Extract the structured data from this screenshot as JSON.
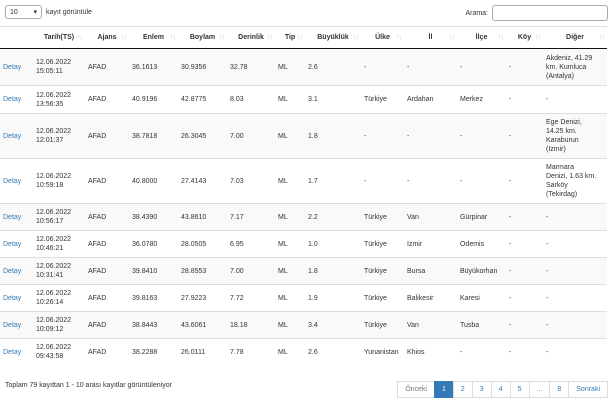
{
  "length_menu": {
    "value": "10",
    "suffix": "kayıt görüntüle"
  },
  "search": {
    "label": "Arama:",
    "placeholder": ""
  },
  "columns": [
    "",
    "Tarih(TS)",
    "Ajans",
    "Enlem",
    "Boylam",
    "Derinlik",
    "Tip",
    "Büyüklük",
    "Ülke",
    "İl",
    "İlçe",
    "Köy",
    "Diğer"
  ],
  "rows": [
    {
      "detail": "Detay",
      "date": "12.06.2022",
      "time": "15:05:11",
      "agency": "AFAD",
      "lat": "36.1613",
      "lon": "30.9356",
      "depth": "32.78",
      "type": "ML",
      "mag": "2.6",
      "country": "-",
      "il": "-",
      "ilce": "-",
      "koy": "-",
      "other": [
        "Akdeniz, 41.29",
        "km. Kumluca",
        "(Antalya)"
      ]
    },
    {
      "detail": "Detay",
      "date": "12.06.2022",
      "time": "13:56:35",
      "agency": "AFAD",
      "lat": "40.9196",
      "lon": "42.8775",
      "depth": "8.03",
      "type": "ML",
      "mag": "3.1",
      "country": "Türkiye",
      "il": "Ardahan",
      "ilce": "Merkez",
      "koy": "-",
      "other": [
        "-"
      ]
    },
    {
      "detail": "Detay",
      "date": "12.06.2022",
      "time": "12:01:37",
      "agency": "AFAD",
      "lat": "38.7818",
      "lon": "26.3045",
      "depth": "7.00",
      "type": "ML",
      "mag": "1.8",
      "country": "-",
      "il": "-",
      "ilce": "-",
      "koy": "-",
      "other": [
        "Ege Denizi,",
        "14.25 km.",
        "Karaburun",
        "(Izmir)"
      ]
    },
    {
      "detail": "Detay",
      "date": "12.06.2022",
      "time": "10:59:18",
      "agency": "AFAD",
      "lat": "40.8000",
      "lon": "27.4143",
      "depth": "7.03",
      "type": "ML",
      "mag": "1.7",
      "country": "-",
      "il": "-",
      "ilce": "-",
      "koy": "-",
      "other": [
        "Marmara",
        "Denizi, 1.63 km.",
        "Sarköy",
        "(Tekirdag)"
      ]
    },
    {
      "detail": "Detay",
      "date": "12.06.2022",
      "time": "10:56:17",
      "agency": "AFAD",
      "lat": "38.4390",
      "lon": "43.8610",
      "depth": "7.17",
      "type": "ML",
      "mag": "2.2",
      "country": "Türkiye",
      "il": "Van",
      "ilce": "Gürpinar",
      "koy": "-",
      "other": [
        "-"
      ]
    },
    {
      "detail": "Detay",
      "date": "12.06.2022",
      "time": "10:46:21",
      "agency": "AFAD",
      "lat": "36.0780",
      "lon": "28.0505",
      "depth": "6.95",
      "type": "ML",
      "mag": "1.0",
      "country": "Türkiye",
      "il": "Izmir",
      "ilce": "Odemis",
      "koy": "-",
      "other": [
        "-"
      ]
    },
    {
      "detail": "Detay",
      "date": "12.06.2022",
      "time": "10:31:41",
      "agency": "AFAD",
      "lat": "39.8410",
      "lon": "28.8553",
      "depth": "7.00",
      "type": "ML",
      "mag": "1.8",
      "country": "Türkiye",
      "il": "Bursa",
      "ilce": "Büyükorhan",
      "koy": "-",
      "other": [
        "-"
      ]
    },
    {
      "detail": "Detay",
      "date": "12.06.2022",
      "time": "10:26:14",
      "agency": "AFAD",
      "lat": "39.8163",
      "lon": "27.9223",
      "depth": "7.72",
      "type": "ML",
      "mag": "1.9",
      "country": "Türkiye",
      "il": "Balikesir",
      "ilce": "Karesi",
      "koy": "-",
      "other": [
        "-"
      ]
    },
    {
      "detail": "Detay",
      "date": "12.06.2022",
      "time": "10:09:12",
      "agency": "AFAD",
      "lat": "38.8443",
      "lon": "43.6061",
      "depth": "18.18",
      "type": "ML",
      "mag": "3.4",
      "country": "Türkiye",
      "il": "Van",
      "ilce": "Tusba",
      "koy": "-",
      "other": [
        "-"
      ]
    },
    {
      "detail": "Detay",
      "date": "12.06.2022",
      "time": "09:43:58",
      "agency": "AFAD",
      "lat": "38.2288",
      "lon": "26.0111",
      "depth": "7.78",
      "type": "ML",
      "mag": "2.6",
      "country": "Yunanistan",
      "il": "Khios",
      "ilce": "-",
      "koy": "-",
      "other": [
        "-"
      ]
    }
  ],
  "info": "Toplam 79 kayıttan 1 - 10 arası kayıtlar görüntüleniyor",
  "pagination": {
    "previous": "Önceki",
    "pages": [
      "1",
      "2",
      "3",
      "4",
      "5",
      "...",
      "8"
    ],
    "active": "1",
    "next": "Sonraki"
  },
  "colors": {
    "link": "#337ab7",
    "active_page": "#337ab7"
  }
}
